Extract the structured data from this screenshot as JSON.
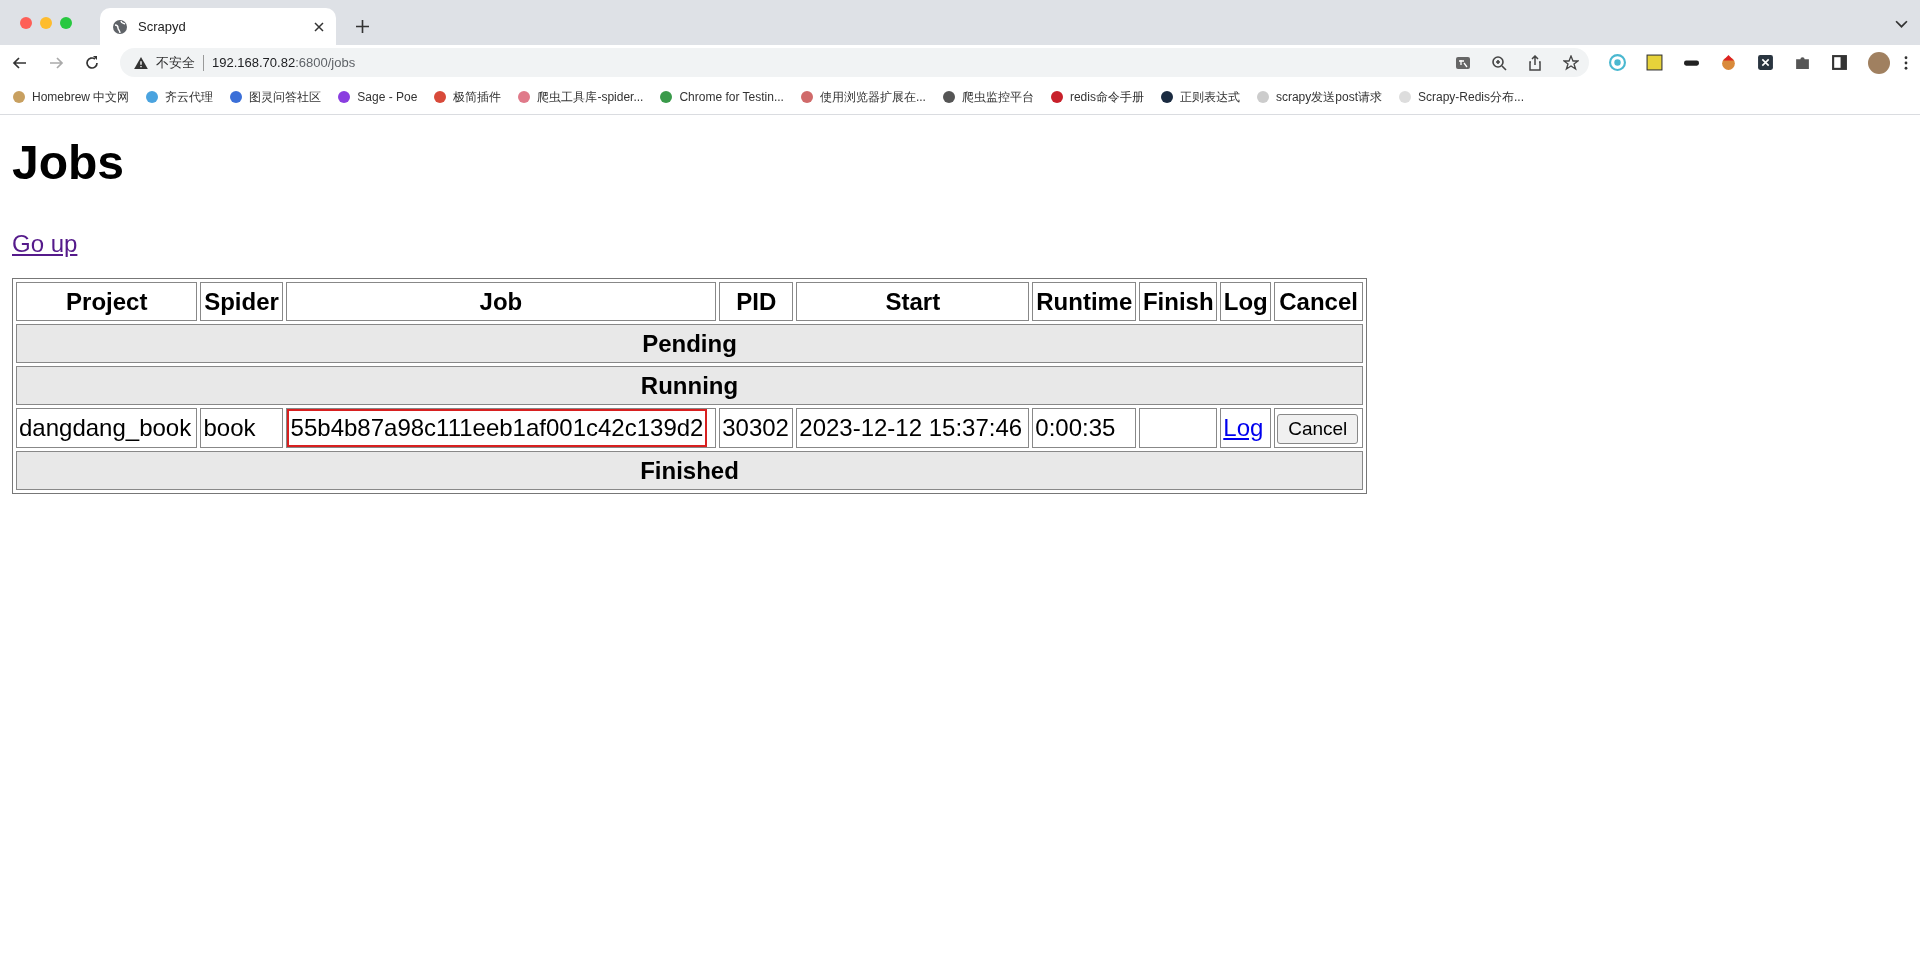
{
  "browser": {
    "tab": {
      "title": "Scrapyd"
    },
    "address": {
      "security": "不安全",
      "host": "192.168.70.82",
      "path": ":6800/jobs"
    },
    "bookmarks": [
      {
        "label": "Homebrew 中文网",
        "color": "#c8a060"
      },
      {
        "label": "齐云代理",
        "color": "#4aa3df"
      },
      {
        "label": "图灵问答社区",
        "color": "#3b6fd8"
      },
      {
        "label": "Sage - Poe",
        "color": "#8a3ee0"
      },
      {
        "label": "极简插件",
        "color": "#d84a3a"
      },
      {
        "label": "爬虫工具库-spider...",
        "color": "#e07a8a"
      },
      {
        "label": "Chrome for Testin...",
        "color": "#3a9a4a"
      },
      {
        "label": "使用浏览器扩展在...",
        "color": "#d06a6a"
      },
      {
        "label": "爬虫监控平台",
        "color": "#555555"
      },
      {
        "label": "redis命令手册",
        "color": "#c8202a"
      },
      {
        "label": "正则表达式",
        "color": "#1a2a40"
      },
      {
        "label": "scrapy发送post请求",
        "color": "#cccccc"
      },
      {
        "label": "Scrapy-Redis分布...",
        "color": "#dddddd"
      }
    ]
  },
  "page": {
    "title": "Jobs",
    "link": "Go up"
  },
  "table": {
    "columns": [
      "Project",
      "Spider",
      "Job",
      "PID",
      "Start",
      "Runtime",
      "Finish",
      "Log",
      "Cancel"
    ],
    "rows": [
      {
        "kind": "section",
        "label": "Pending"
      },
      {
        "kind": "section",
        "label": "Running"
      },
      {
        "kind": "job",
        "project": "dangdang_book",
        "spider": "book",
        "job": "55b4b87a98c111eeb1af001c42c139d2",
        "job_highlighted": true,
        "pid": "30302",
        "start": "2023-12-12 15:37:46",
        "runtime": "0:00:35",
        "log": "Log",
        "cancel": "Cancel"
      },
      {
        "kind": "section",
        "label": "Finished"
      }
    ]
  }
}
